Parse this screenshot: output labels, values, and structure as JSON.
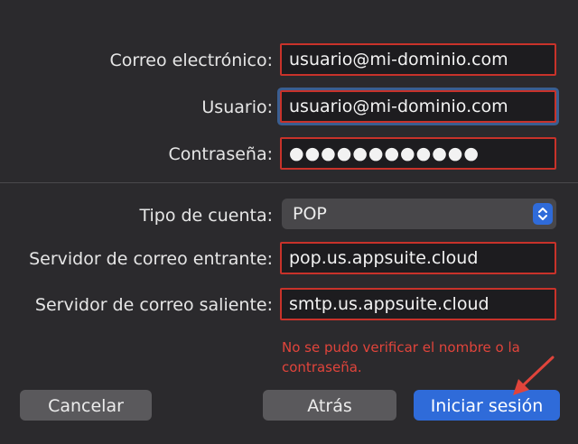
{
  "form": {
    "email": {
      "label": "Correo electrónico:",
      "value": "usuario@mi-dominio.com"
    },
    "username": {
      "label": "Usuario:",
      "value": "usuario@mi-dominio.com"
    },
    "password": {
      "label": "Contraseña:",
      "value": "●●●●●●●●●●●●"
    },
    "account_type": {
      "label": "Tipo de cuenta:",
      "value": "POP"
    },
    "incoming_server": {
      "label": "Servidor de correo entrante:",
      "value": "pop.us.appsuite.cloud"
    },
    "outgoing_server": {
      "label": "Servidor de correo saliente:",
      "value": "smtp.us.appsuite.cloud"
    }
  },
  "error_message": "No se pudo verificar el nombre o la contraseña.",
  "buttons": {
    "cancel": "Cancelar",
    "back": "Atrás",
    "sign_in": "Iniciar sesión"
  },
  "icons": {
    "select_stepper": "chevron-up-down-icon",
    "annotation_arrow": "arrow-annotation-icon"
  },
  "colors": {
    "error": "#e0443b",
    "highlight_border": "#c8322a",
    "accent": "#2f6bd9"
  }
}
